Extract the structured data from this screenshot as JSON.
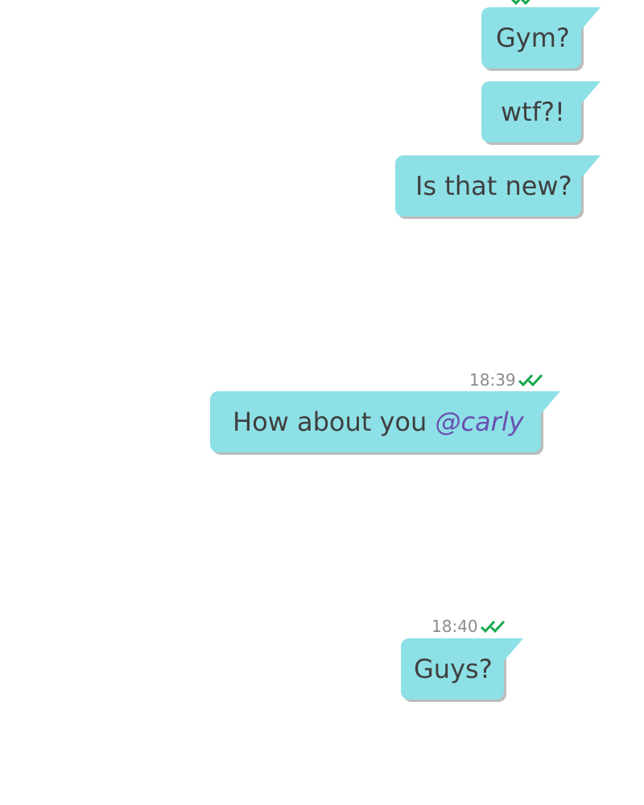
{
  "colors": {
    "bubble": "#8de0e6",
    "text": "#3f3f3f",
    "timestamp": "#8b8b8b",
    "ticks": "#15a84a",
    "mention": "#6a4fb0"
  },
  "messages": [
    {
      "text": "Gym?"
    },
    {
      "text": "wtf?!"
    },
    {
      "text": "Is that new?"
    },
    {
      "time": "18:39",
      "status_icon": "double-check-icon",
      "text": "How about you",
      "mention": "@carly"
    },
    {
      "time": "18:40",
      "status_icon": "double-check-icon",
      "text": "Guys?"
    }
  ]
}
